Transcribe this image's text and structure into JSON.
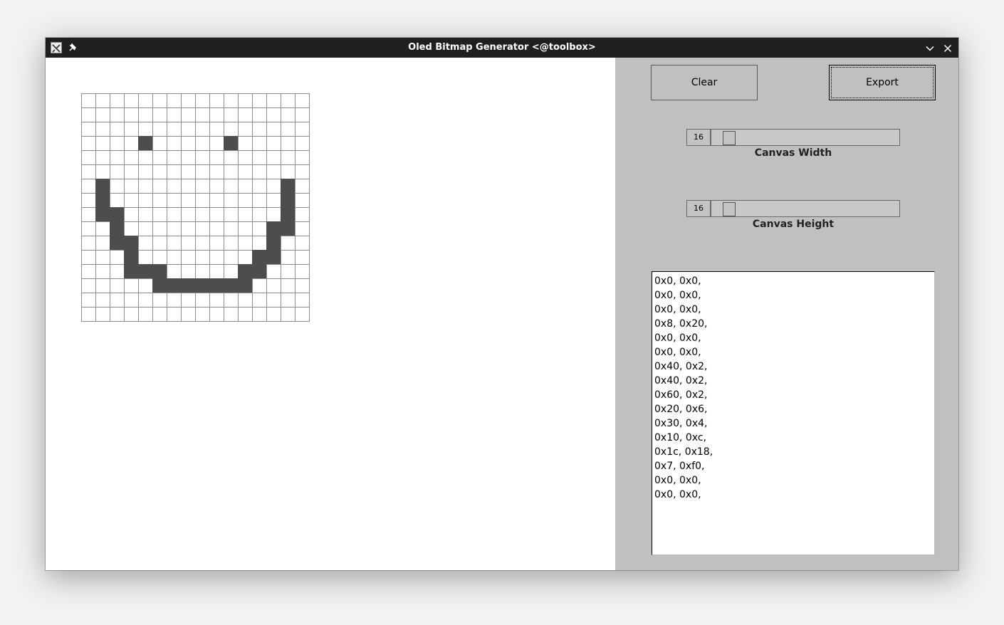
{
  "window": {
    "title": "Oled Bitmap Generator <@toolbox>",
    "icons": [
      "app-icon",
      "pin-icon",
      "chevron-down-icon",
      "close-icon"
    ]
  },
  "canvas": {
    "columns": 16,
    "rows": 16,
    "filled_color": "#4d4d4d",
    "grid_color": "#8c8c8c",
    "pixels": [
      "0000000000000000",
      "0000000000000000",
      "0000000000000000",
      "0000100000100000",
      "0000000000000000",
      "0000000000000000",
      "0100000000000010",
      "0100000000000010",
      "0110000000000010",
      "0010000000000110",
      "0011000000000100",
      "0001000000001100",
      "0001110000011000",
      "0000011111110000",
      "0000000000000000",
      "0000000000000000"
    ]
  },
  "controls": {
    "clear_label": "Clear",
    "export_label": "Export",
    "width_value": "16",
    "width_label": "Canvas Width",
    "height_value": "16",
    "height_label": "Canvas Height"
  },
  "output": {
    "lines": [
      "0x0, 0x0,",
      "0x0, 0x0,",
      "0x0, 0x0,",
      "0x8, 0x20,",
      "0x0, 0x0,",
      "0x0, 0x0,",
      "0x40, 0x2,",
      "0x40, 0x2,",
      "0x60, 0x2,",
      "0x20, 0x6,",
      "0x30, 0x4,",
      "0x10, 0xc,",
      "0x1c, 0x18,",
      "0x7, 0xf0,",
      "0x0, 0x0,",
      "0x0, 0x0,"
    ]
  }
}
